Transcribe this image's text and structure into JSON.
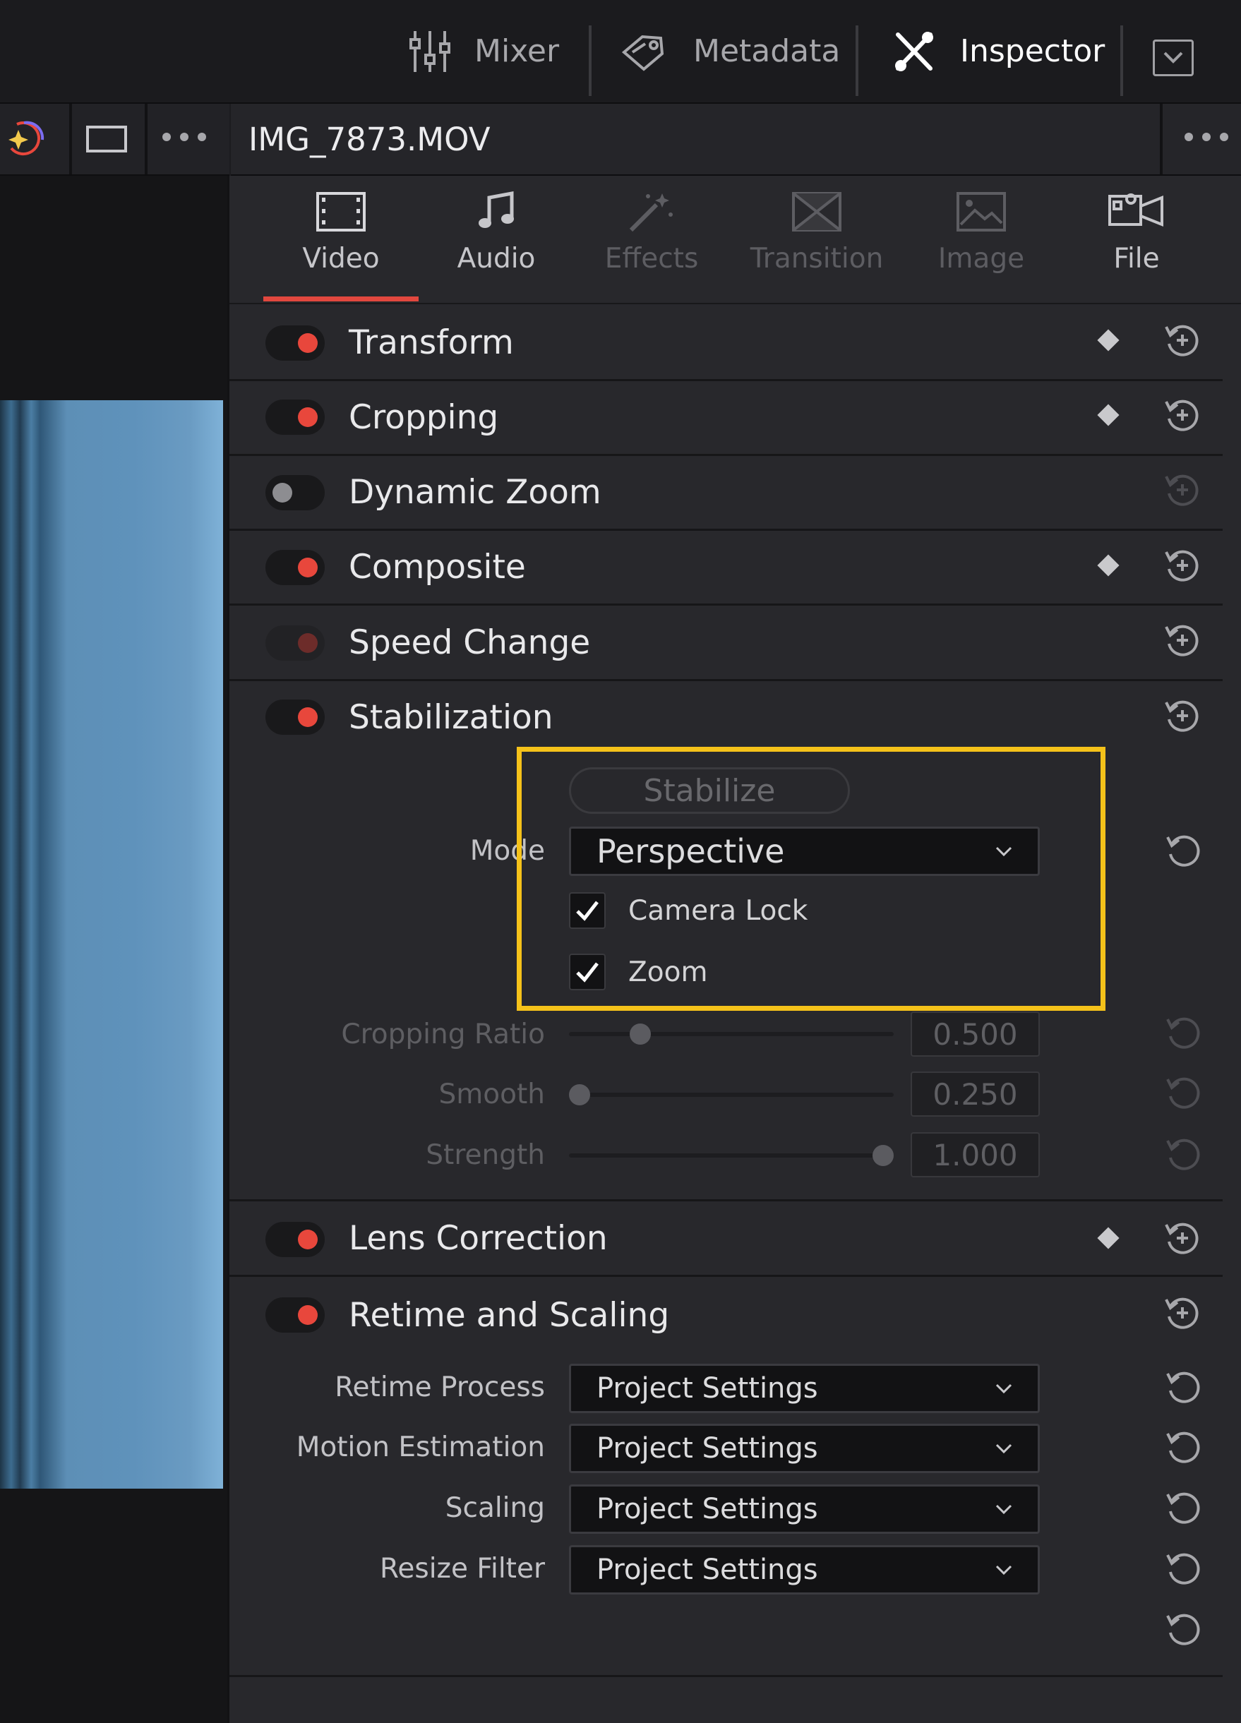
{
  "topbar": {
    "mixer": "Mixer",
    "metadata": "Metadata",
    "inspector": "Inspector"
  },
  "clip": {
    "title": "IMG_7873.MOV"
  },
  "tabs": [
    {
      "label": "Video",
      "active": true
    },
    {
      "label": "Audio"
    },
    {
      "label": "Effects"
    },
    {
      "label": "Transition"
    },
    {
      "label": "Image"
    },
    {
      "label": "File"
    }
  ],
  "sections": {
    "transform": "Transform",
    "cropping": "Cropping",
    "dynamic_zoom": "Dynamic Zoom",
    "composite": "Composite",
    "speed_change": "Speed Change",
    "stabilization": "Stabilization",
    "lens_correction": "Lens Correction",
    "retime_scaling": "Retime and Scaling"
  },
  "stabilization": {
    "stabilize_button": "Stabilize",
    "mode_label": "Mode",
    "mode_value": "Perspective",
    "camera_lock": {
      "label": "Camera Lock",
      "checked": true
    },
    "zoom": {
      "label": "Zoom",
      "checked": true
    },
    "cropping_ratio": {
      "label": "Cropping Ratio",
      "value": "0.500",
      "fraction": 0.2
    },
    "smooth": {
      "label": "Smooth",
      "value": "0.250",
      "fraction": 0.0
    },
    "strength": {
      "label": "Strength",
      "value": "1.000",
      "fraction": 1.0
    }
  },
  "retime": {
    "process": {
      "label": "Retime Process",
      "value": "Project Settings"
    },
    "motion": {
      "label": "Motion Estimation",
      "value": "Project Settings"
    },
    "scaling": {
      "label": "Scaling",
      "value": "Project Settings"
    },
    "resize": {
      "label": "Resize Filter",
      "value": "Project Settings"
    }
  },
  "colors": {
    "accent": "#e8473c",
    "highlight": "#f5c21a"
  }
}
